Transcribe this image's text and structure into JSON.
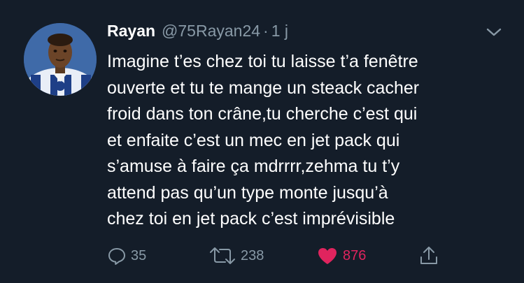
{
  "tweet": {
    "display_name": "Rayan",
    "handle": "@75Rayan24",
    "separator": "·",
    "time": "1 j",
    "lines": [
      "Imagine t’es chez toi tu laisse t’a fenêtre",
      "ouverte et tu te mange un steack cacher",
      "froid dans ton crâne,tu cherche c’est qui",
      "et enfaite c’est un mec en jet pack qui",
      "s’amuse à faire ça mdrrrr,zehma tu t’y",
      "attend pas qu’un type monte jusqu’à",
      "chez toi en jet pack c’est imprévisible"
    ]
  },
  "actions": {
    "reply_icon": "speech-bubble-icon",
    "reply_count": "35",
    "retweet_icon": "retweet-arrows-icon",
    "retweet_count": "238",
    "like_icon": "heart-icon",
    "like_count": "876",
    "share_icon": "share-upload-icon"
  },
  "colors": {
    "background": "#141d29",
    "secondary_text": "#8899a6",
    "like": "#e0245e",
    "primary_text": "#ffffff"
  }
}
